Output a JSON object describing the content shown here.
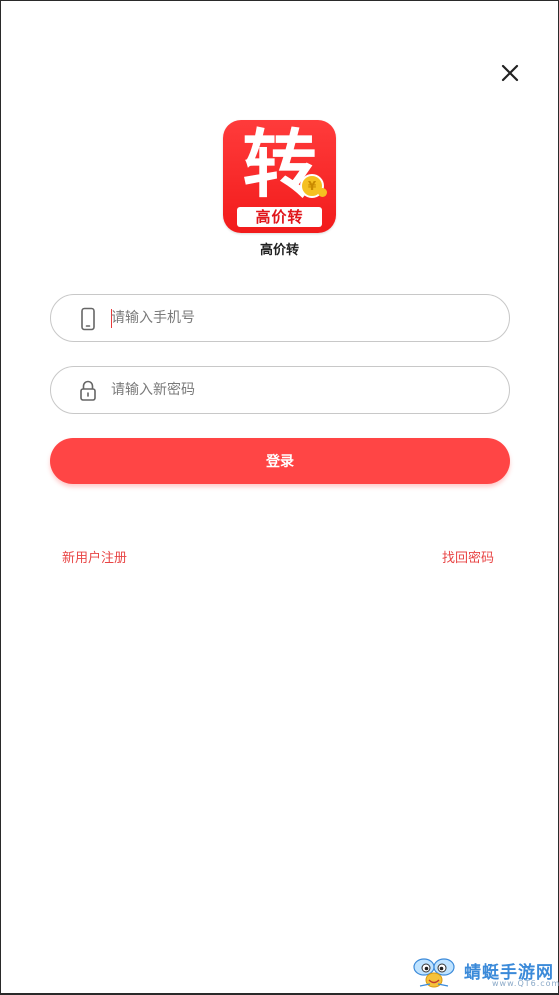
{
  "app": {
    "name": "高价转",
    "logo_glyph": "转",
    "logo_band_text": "高价转",
    "logo_coin_symbol": "¥",
    "brand_color": "#ff4545"
  },
  "form": {
    "phone_placeholder": "请输入手机号",
    "phone_value": "",
    "password_placeholder": "请输入新密码",
    "password_value": "",
    "login_label": "登录"
  },
  "links": {
    "register": "新用户注册",
    "forgot_password": "找回密码"
  },
  "watermark": {
    "title": "蜻蜓手游网",
    "subtitle": "www.QT6.com"
  },
  "icons": {
    "close": "close-icon",
    "phone": "phone-icon",
    "lock": "lock-icon"
  }
}
